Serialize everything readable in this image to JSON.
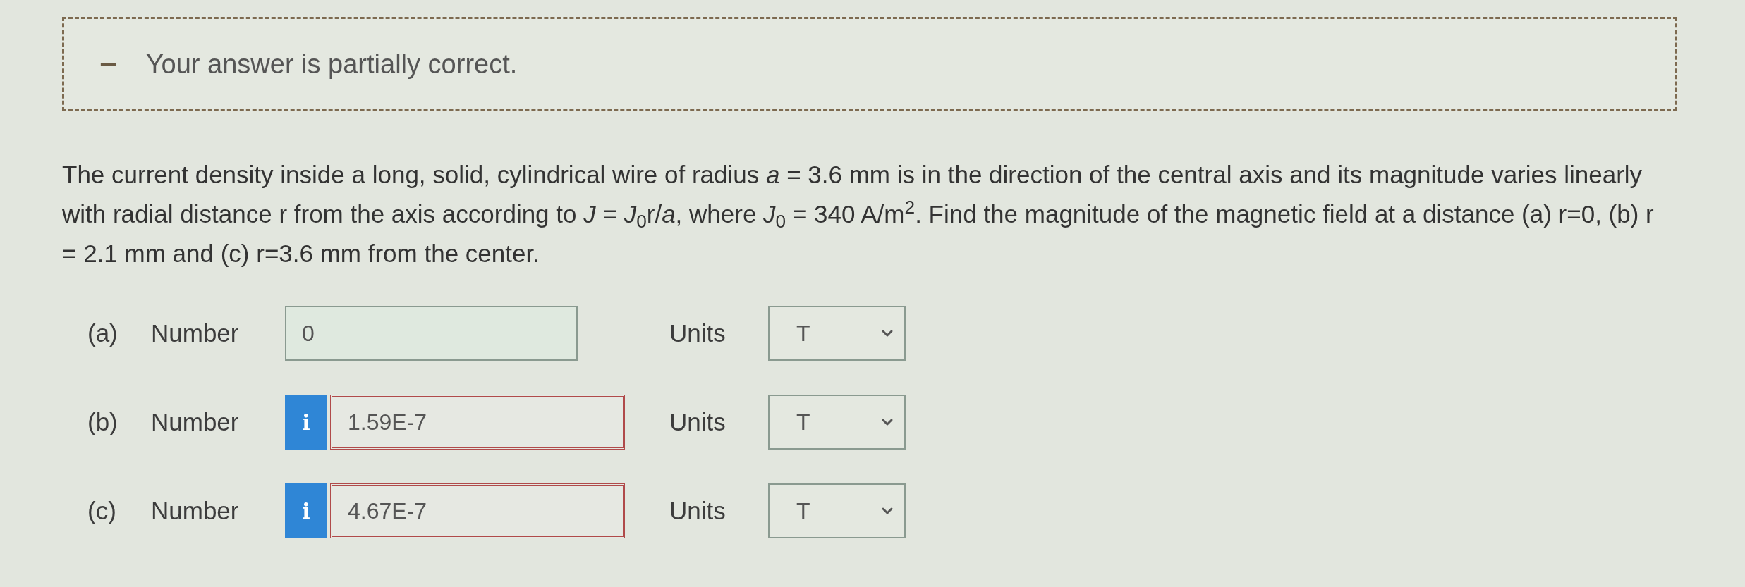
{
  "feedback": {
    "kind": "partial",
    "icon": "−",
    "text": "Your answer is partially correct."
  },
  "question": "The current density inside a long, solid, cylindrical wire of radius *a* = 3.6 mm is in the direction of the central axis and its magnitude varies linearly with radial distance r from the axis according to *J* = *J*$_{0}$r/*a*, where *J*$_{0}$ = 340 A/m$^{2}$. Find the magnitude of the magnetic field at a distance (a) r=0, (b) r = 2.1 mm and (c) r=3.6 mm from the center.",
  "answers": [
    {
      "part": "(a)",
      "label": "Number",
      "value": "0",
      "correct": true,
      "units_label": "Units",
      "units": "T"
    },
    {
      "part": "(b)",
      "label": "Number",
      "info": "i",
      "value": "1.59E-7",
      "correct": false,
      "units_label": "Units",
      "units": "T"
    },
    {
      "part": "(c)",
      "label": "Number",
      "info": "i",
      "value": "4.67E-7",
      "correct": false,
      "units_label": "Units",
      "units": "T"
    }
  ]
}
